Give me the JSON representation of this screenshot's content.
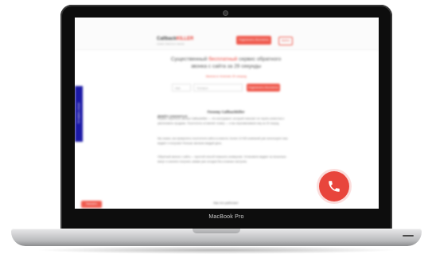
{
  "device": {
    "brand_label": "MacBook Pro"
  },
  "page": {
    "logo": {
      "main": "Callback",
      "accent": "KILLER"
    },
    "logo_sub": "сервис обратного звонка",
    "top_button": "Подключить бесплатно",
    "top_link": "Войти",
    "headline": {
      "prefix": "Существенный",
      "highlight": "бесплатный",
      "rest": "сервис обратного звонка с сайта за 29 секунды"
    },
    "subline": "Звонок в течение 29 секунд",
    "form": {
      "field1_placeholder": "Имя",
      "field2_placeholder": "Телефон",
      "submit_label": "Подключить бесплатно"
    },
    "section_title": "Почему Callbackkiller",
    "para_label": "Давайте знакомиться",
    "paragraphs": [
      "Сервис обратного звонка Callbackkiller — это инструмент, который помогает не терять клиентов и увеличивать продажи. Посетитель оставляет номер — и мы перезваниваем ему за 29 секунд.",
      "Мы знаем, как превратить посетителя сайта в клиента. Более 10 000 компаний уже используют наш виджет и получают больше звонков каждый день.",
      "Обратный звонок с сайта — простой способ повысить конверсию. Установите виджет за несколько минут и начните получать заявки уже сегодня без сложных настроек."
    ],
    "bottom_title": "Как это работает",
    "bottom_button": "Заказать",
    "side_tab": "Оставить отзыв"
  },
  "colors": {
    "accent": "#e8453c",
    "side_tab": "#1c1aa6",
    "bezel": "#0d0d0d"
  },
  "icons": {
    "call": "phone-icon"
  }
}
